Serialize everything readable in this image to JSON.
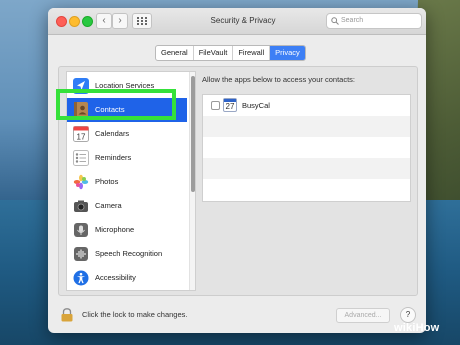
{
  "window": {
    "title": "Security & Privacy"
  },
  "search": {
    "placeholder": "Search"
  },
  "tabs": [
    {
      "label": "General",
      "active": false
    },
    {
      "label": "FileVault",
      "active": false
    },
    {
      "label": "Firewall",
      "active": false
    },
    {
      "label": "Privacy",
      "active": true
    }
  ],
  "sidebar": {
    "items": [
      {
        "label": "Location Services",
        "icon": "location-arrow-icon"
      },
      {
        "label": "Contacts",
        "icon": "contacts-book-icon",
        "selected": true
      },
      {
        "label": "Calendars",
        "icon": "calendar-icon"
      },
      {
        "label": "Reminders",
        "icon": "reminders-list-icon"
      },
      {
        "label": "Photos",
        "icon": "photos-flower-icon"
      },
      {
        "label": "Camera",
        "icon": "camera-icon"
      },
      {
        "label": "Microphone",
        "icon": "microphone-icon"
      },
      {
        "label": "Speech Recognition",
        "icon": "speech-waveform-icon"
      },
      {
        "label": "Accessibility",
        "icon": "accessibility-person-icon"
      }
    ]
  },
  "main": {
    "description": "Allow the apps below to access your contacts:",
    "apps": [
      {
        "name": "BusyCal",
        "icon_text": "27",
        "checked": false
      }
    ]
  },
  "footer": {
    "lock_text": "Click the lock to make changes.",
    "advanced_label": "Advanced...",
    "help_label": "?"
  },
  "watermark": {
    "text": "wikiHow"
  },
  "colors": {
    "selection": "#1f63e8",
    "highlight_box": "#35e13a",
    "tab_active": "#3d7ff5"
  }
}
